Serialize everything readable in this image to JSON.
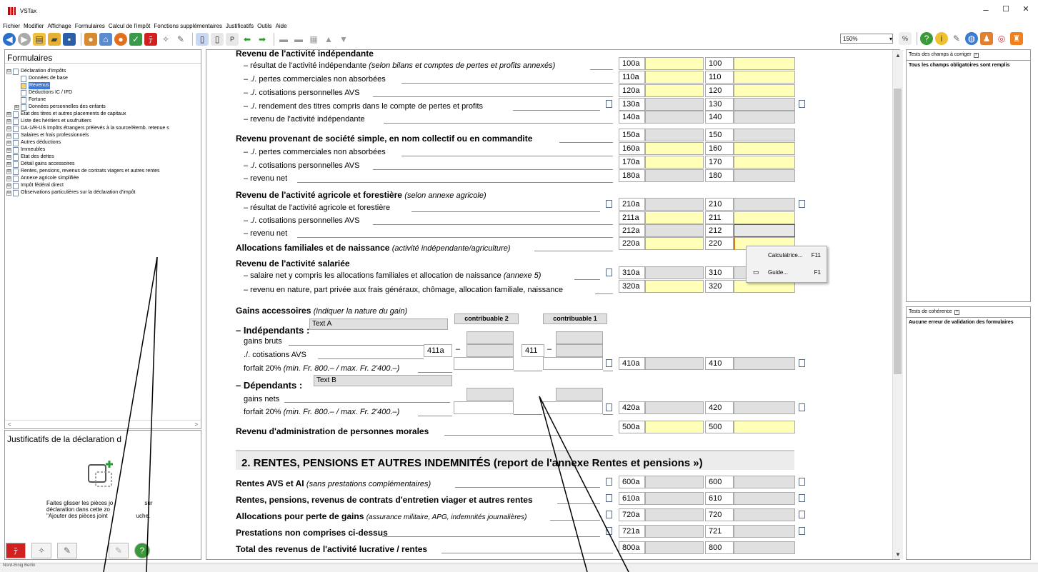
{
  "window": {
    "title": "VSTax",
    "minimize": "–",
    "maximize": "☐",
    "close": "✕"
  },
  "menu": [
    "Fichier",
    "Modifier",
    "Affichage",
    "Formulaires",
    "Calcul de l'impôt",
    "Fonctions supplémentaires",
    "Justificatifs",
    "Outils",
    "Aide"
  ],
  "toolbar": {
    "zoom": "150%"
  },
  "left_panel": {
    "title": "Formulaires",
    "tree": [
      {
        "label": "Déclaration d'impôts",
        "level": 0,
        "expand": "⊟"
      },
      {
        "label": "Données de base",
        "level": 1
      },
      {
        "label": "Revenus",
        "level": 1,
        "selected": true
      },
      {
        "label": "Déductions IC / IFD",
        "level": 1
      },
      {
        "label": "Fortune",
        "level": 1
      },
      {
        "label": "Données personnelles des enfants",
        "level": 1,
        "expand": "⊞"
      },
      {
        "label": "Etat des titres et autres placements de capitaux",
        "level": 0,
        "expand": "⊞"
      },
      {
        "label": "Liste des héritiers et usufruitiers",
        "level": 0,
        "expand": "⊞"
      },
      {
        "label": "DA-1/R-US Impôts étrangers prélevés à la source/Remb. retenue s",
        "level": 0,
        "expand": "⊞"
      },
      {
        "label": "Salaires et frais professionnels",
        "level": 0,
        "expand": "⊞"
      },
      {
        "label": "Autres déductions",
        "level": 0,
        "expand": "⊞"
      },
      {
        "label": "Immeubles",
        "level": 0,
        "expand": "⊞"
      },
      {
        "label": "Etat des dettes",
        "level": 0,
        "expand": "⊞"
      },
      {
        "label": "Détail gains accessoires",
        "level": 0,
        "expand": "⊞"
      },
      {
        "label": "Rentes, pensions, revenus de contrats viagers et autres rentes",
        "level": 0,
        "expand": "⊞"
      },
      {
        "label": "Annexe agricole simplifiée",
        "level": 0,
        "expand": "⊞"
      },
      {
        "label": "Impôt fédéral direct",
        "level": 0,
        "expand": "⊞"
      },
      {
        "label": "Observations particulières sur la déclaration d'impôt",
        "level": 0,
        "expand": "⊞"
      }
    ],
    "scroll_left": "<",
    "scroll_right": ">"
  },
  "attachments_panel": {
    "title": "Justificatifs de la déclaration d",
    "drop_text_1": "Faites glisser les pièces jo",
    "drop_text_1b": "sur",
    "drop_text_2": "déclaration dans cette zo",
    "drop_text_3": "\"Ajouter des pièces joint",
    "drop_text_3b": "uche."
  },
  "status": {
    "text": "Nord-Einig Berlin"
  },
  "form": {
    "s1_title": "Revenu de l'activité indépendante",
    "r100": "– résultat de l'activité indépendante",
    "r100_note": "(selon bilans et comptes de pertes et profits annexés)",
    "r110": "– ./. pertes commerciales non absorbées",
    "r120": "– ./. cotisations personnelles AVS",
    "r130": "– ./. rendement des titres compris dans le compte de pertes et profits",
    "r140": "– revenu de l'activité indépendante",
    "s2_title": "Revenu provenant de société simple, en nom collectif ou en commandite",
    "r160": "– ./. pertes commerciales non absorbées",
    "r170": "– ./. cotisations personnelles AVS",
    "r180": "– revenu net",
    "s3_title": "Revenu de l'activité agricole et forestière",
    "s3_note": "(selon annexe agricole)",
    "r210": "– résultat de l'activité agricole et forestière",
    "r211": "– ./. cotisations personnelles AVS",
    "r212": "– revenu net",
    "r220": "Allocations familiales et de naissance",
    "r220_note": "(activité indépendante/agriculture)",
    "s4_title": "Revenu de l'activité salariée",
    "r310": "– salaire net y compris les allocations familiales et allocation de naissance",
    "r310_note": "(annexe 5)",
    "r320": "– revenu en nature, part privée aux frais généraux, chômage, allocation familiale, naissance",
    "s5_title": "Gains accessoires",
    "s5_note": "(indiquer la nature du gain)",
    "indep": "– Indépendants :",
    "indep_text": "Text A",
    "col2": "contribuable 2",
    "col1": "contribuable 1",
    "gains_bruts": "gains bruts",
    "cot_avs": "./. cotisations AVS",
    "code411a": "411a",
    "code411": "411",
    "forfait": "forfait 20%",
    "forfait_note": "(min. Fr. 800.– / max. Fr. 2'400.–)",
    "depend": "– Dépendants :",
    "depend_text": "Text B",
    "gains_nets": "gains nets",
    "r500": "Revenu d'administration de personnes morales",
    "section2": "2. RENTES, PENSIONS ET AUTRES INDEMNITÉS (report de l'annexe   Rentes et pensions »)",
    "r600": "Rentes AVS et AI",
    "r600_note": "(sans prestations complémentaires)",
    "r610": "Rentes, pensions, revenus de contrats d'entretien viager et autres rentes",
    "r720": "Allocations pour perte de gains",
    "r720_note": "(assurance militaire, APG, indemnités journalières)",
    "r721": "Prestations non comprises ci-dessus",
    "r800": "Total des revenus de l'activité lucrative / rentes",
    "codes": {
      "c100a": "100a",
      "c100": "100",
      "c110a": "110a",
      "c110": "110",
      "c120a": "120a",
      "c120": "120",
      "c130a": "130a",
      "c130": "130",
      "c140a": "140a",
      "c140": "140",
      "c150a": "150a",
      "c150": "150",
      "c160a": "160a",
      "c160": "160",
      "c170a": "170a",
      "c170": "170",
      "c180a": "180a",
      "c180": "180",
      "c210a": "210a",
      "c210": "210",
      "c211a": "211a",
      "c211": "211",
      "c212a": "212a",
      "c212": "212",
      "c220a": "220a",
      "c220": "220",
      "c310a": "310a",
      "c310": "310",
      "c320a": "320a",
      "c320": "320",
      "c410a": "410a",
      "c410": "410",
      "c420a": "420a",
      "c420": "420",
      "c500a": "500a",
      "c500": "500",
      "c600a": "600a",
      "c600": "600",
      "c610a": "610a",
      "c610": "610",
      "c720a": "720a",
      "c720": "720",
      "c721a": "721a",
      "c721": "721",
      "c800a": "800a",
      "c800": "800"
    }
  },
  "context_menu": {
    "calc": "Calculatrice...",
    "calc_key": "F11",
    "guide": "Guide...",
    "guide_key": "F1"
  },
  "right_panels": {
    "p1_title": "Tests des champs à corriger",
    "p1_body": "Tous les champs obligatoires sont remplis",
    "p2_title": "Tests de cohérence",
    "p2_body": "Aucune erreur de validation des formulaires"
  },
  "colors": {
    "yellow_field": "#ffffb8",
    "grey_field": "#e0e0e0",
    "selection": "#3c78d8"
  }
}
